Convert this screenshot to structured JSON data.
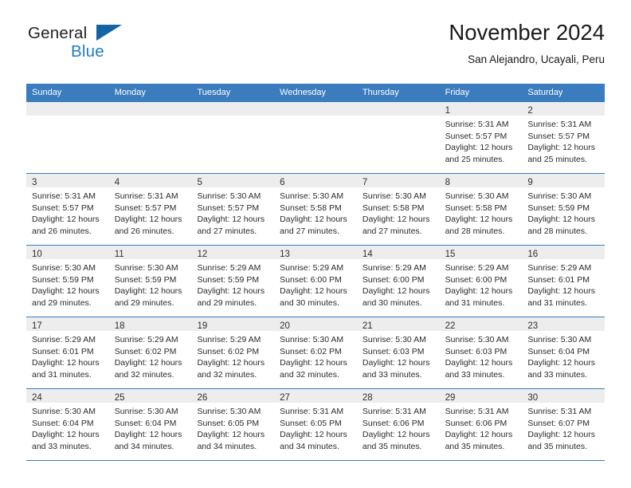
{
  "brand": {
    "name_part1": "General",
    "name_part2": "Blue",
    "flag_icon": "triangle-flag-icon",
    "accent_color": "#1464a5",
    "blue_text_color": "#1f7bc1"
  },
  "header": {
    "title": "November 2024",
    "subtitle": "San Alejandro, Ucayali, Peru"
  },
  "theme": {
    "header_row_bg": "#3a7cbe",
    "day_number_bg": "#ededed",
    "grid_line": "#3a7cbe",
    "text": "#2b2b2b"
  },
  "weekdays": [
    "Sunday",
    "Monday",
    "Tuesday",
    "Wednesday",
    "Thursday",
    "Friday",
    "Saturday"
  ],
  "weeks": [
    [
      {
        "day": "",
        "empty": true
      },
      {
        "day": "",
        "empty": true
      },
      {
        "day": "",
        "empty": true
      },
      {
        "day": "",
        "empty": true
      },
      {
        "day": "",
        "empty": true
      },
      {
        "day": "1",
        "sunrise": "Sunrise: 5:31 AM",
        "sunset": "Sunset: 5:57 PM",
        "daylight1": "Daylight: 12 hours",
        "daylight2": "and 25 minutes."
      },
      {
        "day": "2",
        "sunrise": "Sunrise: 5:31 AM",
        "sunset": "Sunset: 5:57 PM",
        "daylight1": "Daylight: 12 hours",
        "daylight2": "and 25 minutes."
      }
    ],
    [
      {
        "day": "3",
        "sunrise": "Sunrise: 5:31 AM",
        "sunset": "Sunset: 5:57 PM",
        "daylight1": "Daylight: 12 hours",
        "daylight2": "and 26 minutes."
      },
      {
        "day": "4",
        "sunrise": "Sunrise: 5:31 AM",
        "sunset": "Sunset: 5:57 PM",
        "daylight1": "Daylight: 12 hours",
        "daylight2": "and 26 minutes."
      },
      {
        "day": "5",
        "sunrise": "Sunrise: 5:30 AM",
        "sunset": "Sunset: 5:57 PM",
        "daylight1": "Daylight: 12 hours",
        "daylight2": "and 27 minutes."
      },
      {
        "day": "6",
        "sunrise": "Sunrise: 5:30 AM",
        "sunset": "Sunset: 5:58 PM",
        "daylight1": "Daylight: 12 hours",
        "daylight2": "and 27 minutes."
      },
      {
        "day": "7",
        "sunrise": "Sunrise: 5:30 AM",
        "sunset": "Sunset: 5:58 PM",
        "daylight1": "Daylight: 12 hours",
        "daylight2": "and 27 minutes."
      },
      {
        "day": "8",
        "sunrise": "Sunrise: 5:30 AM",
        "sunset": "Sunset: 5:58 PM",
        "daylight1": "Daylight: 12 hours",
        "daylight2": "and 28 minutes."
      },
      {
        "day": "9",
        "sunrise": "Sunrise: 5:30 AM",
        "sunset": "Sunset: 5:59 PM",
        "daylight1": "Daylight: 12 hours",
        "daylight2": "and 28 minutes."
      }
    ],
    [
      {
        "day": "10",
        "sunrise": "Sunrise: 5:30 AM",
        "sunset": "Sunset: 5:59 PM",
        "daylight1": "Daylight: 12 hours",
        "daylight2": "and 29 minutes."
      },
      {
        "day": "11",
        "sunrise": "Sunrise: 5:30 AM",
        "sunset": "Sunset: 5:59 PM",
        "daylight1": "Daylight: 12 hours",
        "daylight2": "and 29 minutes."
      },
      {
        "day": "12",
        "sunrise": "Sunrise: 5:29 AM",
        "sunset": "Sunset: 5:59 PM",
        "daylight1": "Daylight: 12 hours",
        "daylight2": "and 29 minutes."
      },
      {
        "day": "13",
        "sunrise": "Sunrise: 5:29 AM",
        "sunset": "Sunset: 6:00 PM",
        "daylight1": "Daylight: 12 hours",
        "daylight2": "and 30 minutes."
      },
      {
        "day": "14",
        "sunrise": "Sunrise: 5:29 AM",
        "sunset": "Sunset: 6:00 PM",
        "daylight1": "Daylight: 12 hours",
        "daylight2": "and 30 minutes."
      },
      {
        "day": "15",
        "sunrise": "Sunrise: 5:29 AM",
        "sunset": "Sunset: 6:00 PM",
        "daylight1": "Daylight: 12 hours",
        "daylight2": "and 31 minutes."
      },
      {
        "day": "16",
        "sunrise": "Sunrise: 5:29 AM",
        "sunset": "Sunset: 6:01 PM",
        "daylight1": "Daylight: 12 hours",
        "daylight2": "and 31 minutes."
      }
    ],
    [
      {
        "day": "17",
        "sunrise": "Sunrise: 5:29 AM",
        "sunset": "Sunset: 6:01 PM",
        "daylight1": "Daylight: 12 hours",
        "daylight2": "and 31 minutes."
      },
      {
        "day": "18",
        "sunrise": "Sunrise: 5:29 AM",
        "sunset": "Sunset: 6:02 PM",
        "daylight1": "Daylight: 12 hours",
        "daylight2": "and 32 minutes."
      },
      {
        "day": "19",
        "sunrise": "Sunrise: 5:29 AM",
        "sunset": "Sunset: 6:02 PM",
        "daylight1": "Daylight: 12 hours",
        "daylight2": "and 32 minutes."
      },
      {
        "day": "20",
        "sunrise": "Sunrise: 5:30 AM",
        "sunset": "Sunset: 6:02 PM",
        "daylight1": "Daylight: 12 hours",
        "daylight2": "and 32 minutes."
      },
      {
        "day": "21",
        "sunrise": "Sunrise: 5:30 AM",
        "sunset": "Sunset: 6:03 PM",
        "daylight1": "Daylight: 12 hours",
        "daylight2": "and 33 minutes."
      },
      {
        "day": "22",
        "sunrise": "Sunrise: 5:30 AM",
        "sunset": "Sunset: 6:03 PM",
        "daylight1": "Daylight: 12 hours",
        "daylight2": "and 33 minutes."
      },
      {
        "day": "23",
        "sunrise": "Sunrise: 5:30 AM",
        "sunset": "Sunset: 6:04 PM",
        "daylight1": "Daylight: 12 hours",
        "daylight2": "and 33 minutes."
      }
    ],
    [
      {
        "day": "24",
        "sunrise": "Sunrise: 5:30 AM",
        "sunset": "Sunset: 6:04 PM",
        "daylight1": "Daylight: 12 hours",
        "daylight2": "and 33 minutes."
      },
      {
        "day": "25",
        "sunrise": "Sunrise: 5:30 AM",
        "sunset": "Sunset: 6:04 PM",
        "daylight1": "Daylight: 12 hours",
        "daylight2": "and 34 minutes."
      },
      {
        "day": "26",
        "sunrise": "Sunrise: 5:30 AM",
        "sunset": "Sunset: 6:05 PM",
        "daylight1": "Daylight: 12 hours",
        "daylight2": "and 34 minutes."
      },
      {
        "day": "27",
        "sunrise": "Sunrise: 5:31 AM",
        "sunset": "Sunset: 6:05 PM",
        "daylight1": "Daylight: 12 hours",
        "daylight2": "and 34 minutes."
      },
      {
        "day": "28",
        "sunrise": "Sunrise: 5:31 AM",
        "sunset": "Sunset: 6:06 PM",
        "daylight1": "Daylight: 12 hours",
        "daylight2": "and 35 minutes."
      },
      {
        "day": "29",
        "sunrise": "Sunrise: 5:31 AM",
        "sunset": "Sunset: 6:06 PM",
        "daylight1": "Daylight: 12 hours",
        "daylight2": "and 35 minutes."
      },
      {
        "day": "30",
        "sunrise": "Sunrise: 5:31 AM",
        "sunset": "Sunset: 6:07 PM",
        "daylight1": "Daylight: 12 hours",
        "daylight2": "and 35 minutes."
      }
    ]
  ]
}
